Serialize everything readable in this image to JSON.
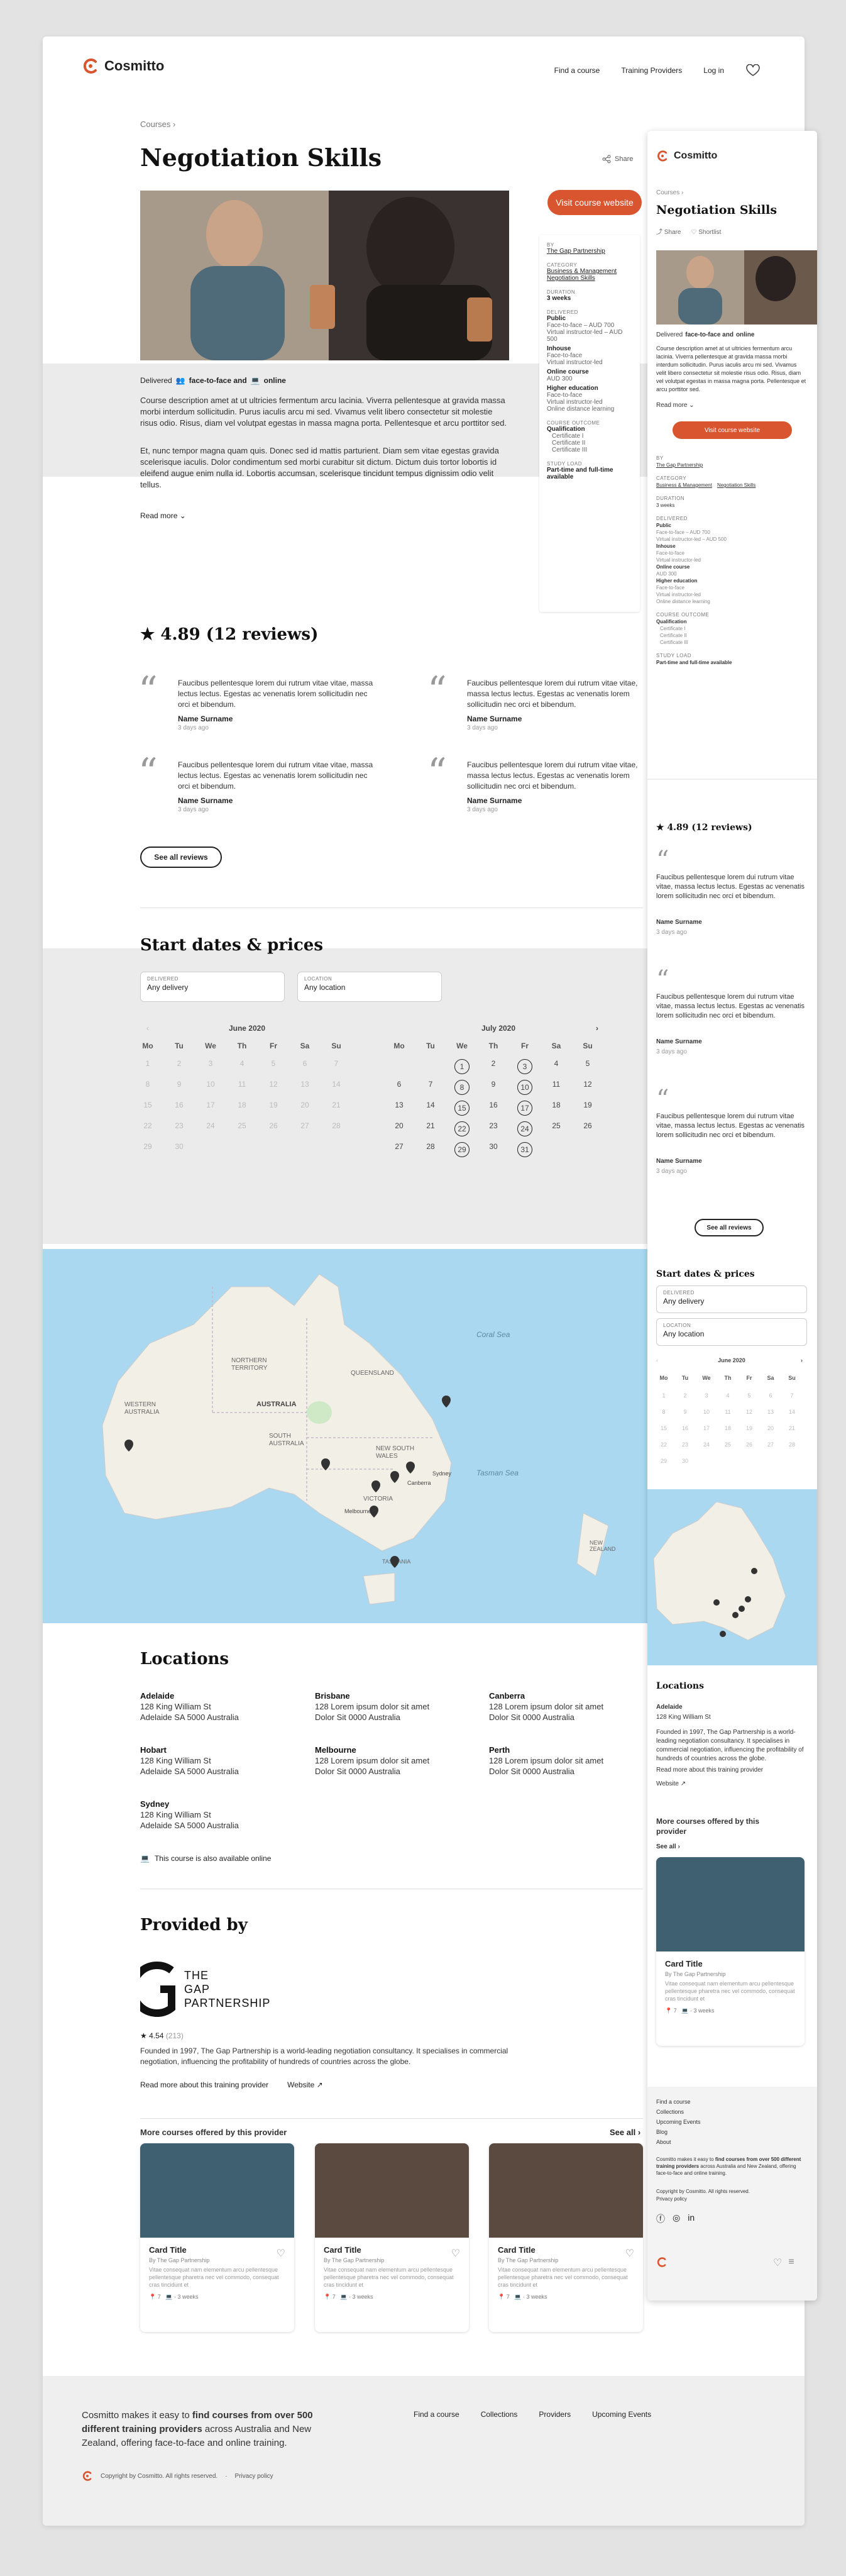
{
  "header": {
    "brand": "Cosmitto",
    "nav": [
      "Find a course",
      "Training Providers",
      "Log in"
    ]
  },
  "breadcrumb": "Courses",
  "course": {
    "title": "Negotiation Skills",
    "delivered_prefix": "Delivered",
    "delivery_a": "face-to-face and",
    "delivery_b": "online",
    "desc1": "Course description amet at ut ultricies fermentum arcu lacinia. Viverra pellentesque at gravida massa morbi interdum sollicitudin. Purus iaculis arcu mi sed. Vivamus velit libero consectetur sit molestie risus odio. Risus, diam vel volutpat egestas in massa magna porta. Pellentesque et arcu porttitor sed.",
    "desc2": "Et, nunc tempor magna quam quis. Donec sed id mattis parturient. Diam sem vitae egestas gravida scelerisque iaculis. Dolor condimentum sed morbi curabitur sit dictum. Dictum duis tortor lobortis id eleifend augue enim nulla id. Lobortis accumsan, scelerisque tincidunt tempus dignissim odio velit tellus.",
    "read_more": "Read more",
    "share": "Share",
    "shortlist": "Shortlist",
    "visit": "Visit course website"
  },
  "info": {
    "by_label": "BY",
    "by": "The Gap Partnership",
    "cat_label": "CATEGORY",
    "cat1": "Business & Management",
    "cat2": "Negotiation Skills",
    "dur_label": "DURATION",
    "dur": "3 weeks",
    "del_label": "DELIVERED",
    "public": "Public",
    "public1": "Face-to-face – AUD 700",
    "public2": "Virtual instructor-led – AUD 500",
    "inhouse": "Inhouse",
    "inhouse1": "Face-to-face",
    "inhouse2": "Virtual instructor-led",
    "online": "Online course",
    "online1": "AUD 300",
    "higher": "Higher education",
    "higher1": "Face-to-face",
    "higher2": "Virtual instructor-led",
    "higher3": "Online distance learning",
    "outcome_label": "COURSE OUTCOME",
    "qual": "Qualification",
    "c1": "Certificate I",
    "c2": "Certificate II",
    "c3": "Certificate III",
    "load_label": "STUDY LOAD",
    "load": "Part-time and full-time available"
  },
  "reviews": {
    "heading": "4.89 (12 reviews)",
    "text": "Faucibus pellentesque lorem dui rutrum vitae vitae, massa lectus lectus. Egestas ac venenatis lorem sollicitudin nec orci et bibendum.",
    "name": "Name Surname",
    "date": "3 days ago",
    "see_all": "See all reviews"
  },
  "dates": {
    "heading": "Start dates & prices",
    "delivery_label": "DELIVERED",
    "delivery_value": "Any delivery",
    "location_label": "LOCATION",
    "location_value": "Any location",
    "m1": "June 2020",
    "m2": "July 2020",
    "dow": [
      "Mo",
      "Tu",
      "We",
      "Th",
      "Fr",
      "Sa",
      "Su"
    ]
  },
  "map": {
    "labels": [
      "NORTHERN TERRITORY",
      "QUEENSLAND",
      "WESTERN AUSTRALIA",
      "AUSTRALIA",
      "SOUTH AUSTRALIA",
      "NEW SOUTH WALES",
      "VICTORIA",
      "TASMANIA",
      "Coral Sea",
      "Tasman Sea",
      "NEW ZEALAND",
      "Sydney",
      "Canberra",
      "Melbourne"
    ]
  },
  "locations": {
    "heading": "Locations",
    "items": [
      {
        "city": "Adelaide",
        "l1": "128 King William St",
        "l2": "Adelaide SA 5000 Australia"
      },
      {
        "city": "Brisbane",
        "l1": "128 Lorem ipsum dolor sit amet",
        "l2": "Dolor Sit 0000 Australia"
      },
      {
        "city": "Canberra",
        "l1": "128 Lorem ipsum dolor sit amet",
        "l2": "Dolor Sit 0000 Australia"
      },
      {
        "city": "Hobart",
        "l1": "128 King William St",
        "l2": "Adelaide SA 5000 Australia"
      },
      {
        "city": "Melbourne",
        "l1": "128 Lorem ipsum dolor sit amet",
        "l2": "Dolor Sit 0000 Australia"
      },
      {
        "city": "Perth",
        "l1": "128 Lorem ipsum dolor sit amet",
        "l2": "Dolor Sit 0000 Australia"
      },
      {
        "city": "Sydney",
        "l1": "128 King William St",
        "l2": "Adelaide SA 5000 Australia"
      }
    ],
    "online_note": "This course is also available online"
  },
  "provider": {
    "heading": "Provided by",
    "logo1": "THE",
    "logo2": "GAP",
    "logo3": "PARTNERSHIP",
    "rating": "4.54",
    "count": "(213)",
    "about": "Founded in 1997, The Gap Partnership is a world-leading negotiation consultancy. It specialises in commercial negotiation, influencing the profitability of hundreds of countries across the globe.",
    "read_more": "Read more about this training provider",
    "website": "Website"
  },
  "more": {
    "heading": "More courses offered by this provider",
    "see_all": "See all",
    "card_title": "Card Title",
    "card_by": "By The Gap Partnership",
    "card_desc": "Vitae consequat nam elementum arcu pellentesque pellentesque pharetra nec vel commodo, consequat cras tincidunt et",
    "card_count": "7",
    "card_dur": "3 weeks"
  },
  "footer": {
    "blurb_a": "Cosmitto makes it easy to ",
    "blurb_b": "find courses from over 500 different training providers",
    "blurb_c": " across Australia and New Zealand, offering face-to-face and online training.",
    "links": [
      "Find a course",
      "Collections",
      "Providers",
      "Upcoming Events"
    ],
    "copy": "Copyright by Cosmitto. All rights reserved.",
    "privacy": "Privacy policy"
  },
  "mobile": {
    "more_heading": "More courses offered by this provider",
    "see_all": "See all",
    "footer_links": [
      "Find a course",
      "Collections",
      "Upcoming Events",
      "Blog",
      "About"
    ],
    "copy": "Copyright by Cosmitto. All rights reserved.",
    "privacy": "Privacy policy"
  },
  "colors": {
    "accent": "#d9552f",
    "map_water": "#a9d8f0",
    "land": "#f2efe6"
  }
}
